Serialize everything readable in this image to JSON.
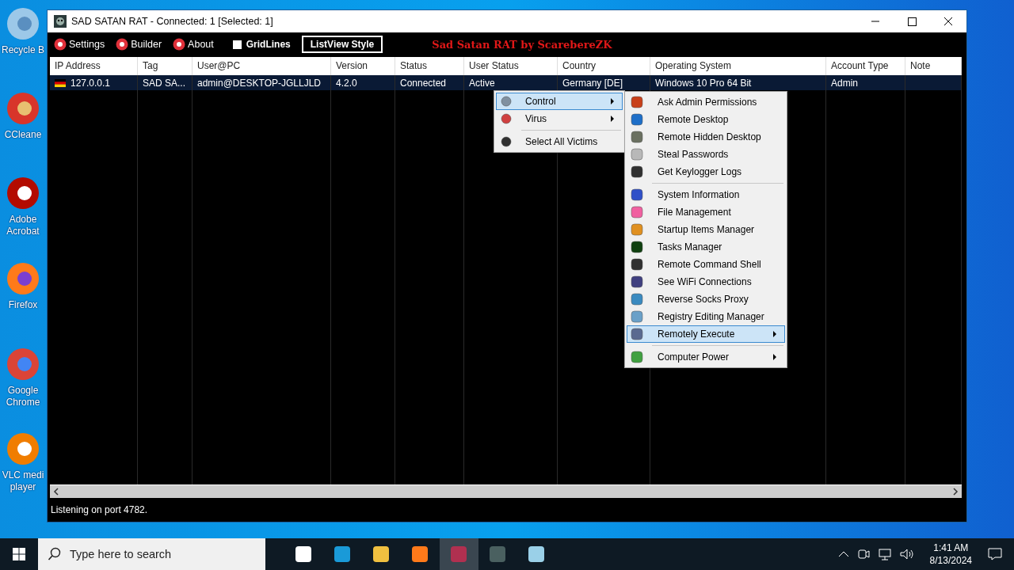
{
  "desktop_icons": [
    {
      "label": "Recycle B"
    },
    {
      "label": "CCleane"
    },
    {
      "label": "Adobe Acrobat"
    },
    {
      "label": "Firefox"
    },
    {
      "label": "Google Chrome"
    },
    {
      "label": "VLC medi player"
    }
  ],
  "window": {
    "title": "SAD SATAN RAT - Connected: 1 [Selected: 1]"
  },
  "toolbar": [
    {
      "kind": "button",
      "label": "Settings"
    },
    {
      "kind": "button",
      "label": "Builder"
    },
    {
      "kind": "button",
      "label": "About"
    },
    {
      "kind": "checkbox",
      "label": "GridLines",
      "checked": false
    },
    {
      "kind": "outlined",
      "label": "ListView Style"
    }
  ],
  "banner": "Sad Satan RAT by ScarebereZK",
  "table": {
    "columns": [
      "IP Address",
      "Tag",
      "User@PC",
      "Version",
      "Status",
      "User Status",
      "Country",
      "Operating System",
      "Account Type",
      "Note"
    ],
    "rows": [
      {
        "selected": true,
        "cells": [
          "127.0.0.1",
          "SAD SA...",
          "admin@DESKTOP-JGLLJLD",
          "4.2.0",
          "Connected",
          "Active",
          "Germany [DE]",
          "Windows 10 Pro 64 Bit",
          "Admin",
          ""
        ]
      }
    ]
  },
  "status_bar": "Listening on port 4782.",
  "context_menu": [
    {
      "kind": "item",
      "label": "Control",
      "submenu": true,
      "selected": true
    },
    {
      "kind": "item",
      "label": "Virus",
      "submenu": true,
      "selected": false
    },
    {
      "kind": "separator"
    },
    {
      "kind": "item",
      "label": "Select All Victims",
      "submenu": false,
      "selected": false
    }
  ],
  "submenu": [
    {
      "kind": "item",
      "label": "Ask Admin Permissions",
      "submenu": false,
      "selected": false
    },
    {
      "kind": "item",
      "label": "Remote Desktop",
      "submenu": false,
      "selected": false
    },
    {
      "kind": "item",
      "label": "Remote Hidden Desktop",
      "submenu": false,
      "selected": false
    },
    {
      "kind": "item",
      "label": "Steal Passwords",
      "submenu": false,
      "selected": false
    },
    {
      "kind": "item",
      "label": "Get Keylogger Logs",
      "submenu": false,
      "selected": false
    },
    {
      "kind": "separator"
    },
    {
      "kind": "item",
      "label": "System Information",
      "submenu": false,
      "selected": false
    },
    {
      "kind": "item",
      "label": "File Management",
      "submenu": false,
      "selected": false
    },
    {
      "kind": "item",
      "label": "Startup Items Manager",
      "submenu": false,
      "selected": false
    },
    {
      "kind": "item",
      "label": "Tasks Manager",
      "submenu": false,
      "selected": false
    },
    {
      "kind": "item",
      "label": "Remote Command Shell",
      "submenu": false,
      "selected": false
    },
    {
      "kind": "item",
      "label": "See WiFi Connections",
      "submenu": false,
      "selected": false
    },
    {
      "kind": "item",
      "label": "Reverse Socks Proxy",
      "submenu": false,
      "selected": false
    },
    {
      "kind": "item",
      "label": "Registry Editing Manager",
      "submenu": false,
      "selected": false
    },
    {
      "kind": "item",
      "label": "Remotely Execute",
      "submenu": true,
      "selected": true
    },
    {
      "kind": "separator"
    },
    {
      "kind": "item",
      "label": "Computer Power",
      "submenu": true,
      "selected": false
    }
  ],
  "taskbar": {
    "search": {
      "placeholder": "Type here to search"
    },
    "time": "1:41 AM",
    "date": "8/13/2024"
  }
}
